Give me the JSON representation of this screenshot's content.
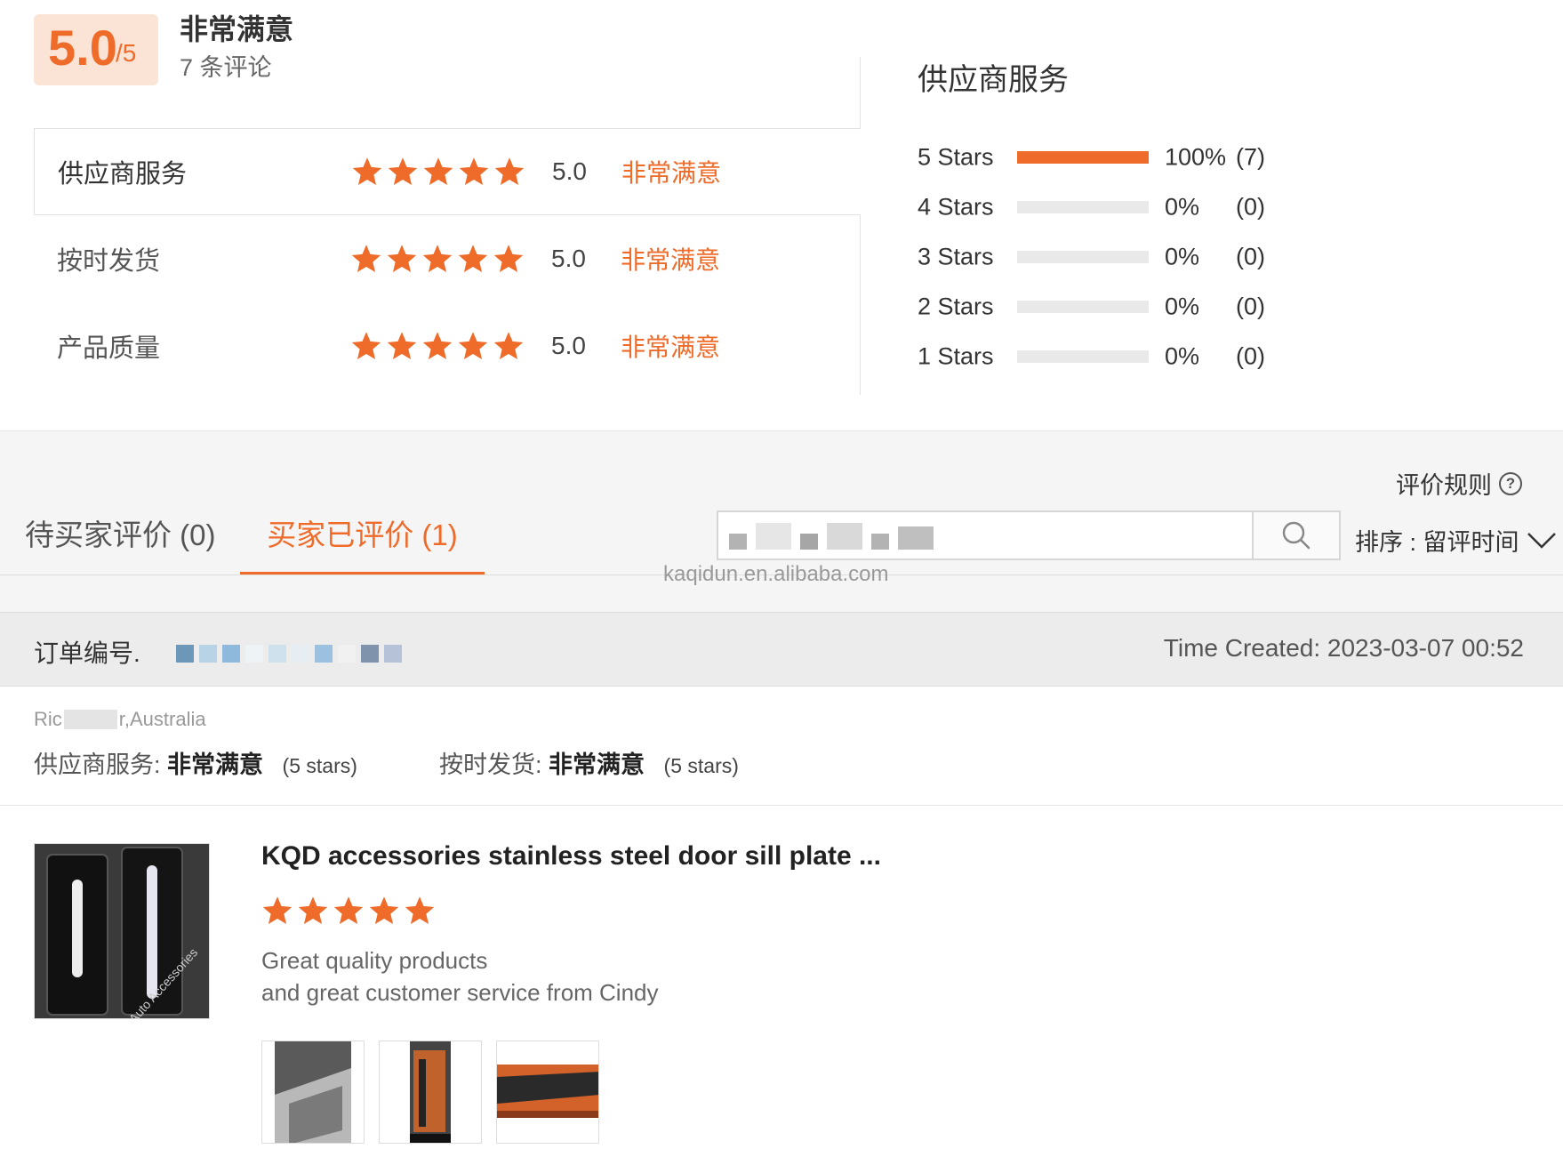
{
  "overall": {
    "score": "5.0",
    "score_max": "/5",
    "label": "非常满意",
    "review_count": "7 条评论",
    "star_color": "#ee6b2a"
  },
  "categories": [
    {
      "name": "供应商服务",
      "stars": 5,
      "score": "5.0",
      "label": "非常满意"
    },
    {
      "name": "按时发货",
      "stars": 5,
      "score": "5.0",
      "label": "非常满意"
    },
    {
      "name": "产品质量",
      "stars": 5,
      "score": "5.0",
      "label": "非常满意"
    }
  ],
  "distribution": {
    "title": "供应商服务",
    "rows": [
      {
        "label": "5  Stars",
        "fraction": 1.0,
        "percent": "100%",
        "count": "(7)"
      },
      {
        "label": "4  Stars",
        "fraction": 0.0,
        "percent": "0%",
        "count": "(0)"
      },
      {
        "label": "3  Stars",
        "fraction": 0.0,
        "percent": "0%",
        "count": "(0)"
      },
      {
        "label": "2  Stars",
        "fraction": 0.0,
        "percent": "0%",
        "count": "(0)"
      },
      {
        "label": "1  Stars",
        "fraction": 0.0,
        "percent": "0%",
        "count": "(0)"
      }
    ]
  },
  "toolbar": {
    "rules_link": "评价规则",
    "help_icon": "?",
    "tabs": [
      {
        "label": "待买家评价 (0)",
        "active": false
      },
      {
        "label": "买家已评价 (1)",
        "active": true
      }
    ],
    "search_icon": "search-icon",
    "sort_label": "排序 : 留评时间",
    "sort_icon": "chevron-down-icon",
    "watermark": "kaqidun.en.alibaba.com"
  },
  "order": {
    "label": "订单编号.",
    "time_created": "Time Created: 2023-03-07 00:52"
  },
  "review": {
    "buyer_prefix": "Ric",
    "buyer_suffix": "r,Australia",
    "supplier_service_label": "供应商服务:",
    "supplier_service_value": "非常满意",
    "supplier_service_stars": "(5 stars)",
    "shipment_label": "按时发货:",
    "shipment_value": "非常满意",
    "shipment_stars": "(5 stars)"
  },
  "product": {
    "title": "KQD accessories stainless steel door sill plate ...",
    "stars": 5,
    "thumb_caption": "Auto Accessories",
    "comment_line1": "Great quality products",
    "comment_line2": "and great customer service from Cindy",
    "photo_count": 3
  }
}
